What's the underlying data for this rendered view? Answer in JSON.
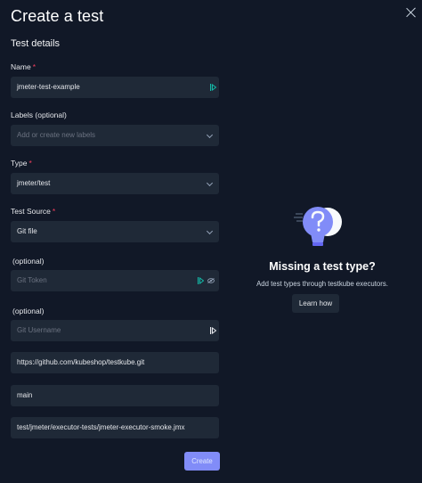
{
  "modal": {
    "title": "Create a test",
    "section_title": "Test details"
  },
  "form": {
    "name": {
      "label": "Name",
      "required": "*",
      "value": "jmeter-test-example"
    },
    "labels": {
      "label": "Labels (optional)",
      "placeholder": "Add or create new labels"
    },
    "type": {
      "label": "Type",
      "required": "*",
      "value": "jmeter/test"
    },
    "source": {
      "label": "Test Source",
      "required": "*",
      "value": "Git file"
    },
    "git_token": {
      "label": "(optional)",
      "placeholder": "Git Token"
    },
    "git_username": {
      "label": "(optional)",
      "placeholder": "Git Username"
    },
    "repo_uri": {
      "value": "https://github.com/kubeshop/testkube.git"
    },
    "branch": {
      "value": "main"
    },
    "path": {
      "value": "test/jmeter/executor-tests/jmeter-executor-smoke.jmx"
    },
    "create_label": "Create"
  },
  "empty_state": {
    "title": "Missing a test type?",
    "subtitle": "Add test types through testkube executors.",
    "button_label": "Learn how"
  },
  "icons": {
    "close": "close-icon",
    "chevron": "chevron-down-icon",
    "autofill": "autofill-icon",
    "visibility": "eye-off-icon",
    "illustration": "question-bulb-icon"
  },
  "colors": {
    "background": "#111827",
    "field": "#1f2937",
    "accent": "#818cf8",
    "required": "#f43f5e",
    "autofill": "#14b8a6"
  }
}
